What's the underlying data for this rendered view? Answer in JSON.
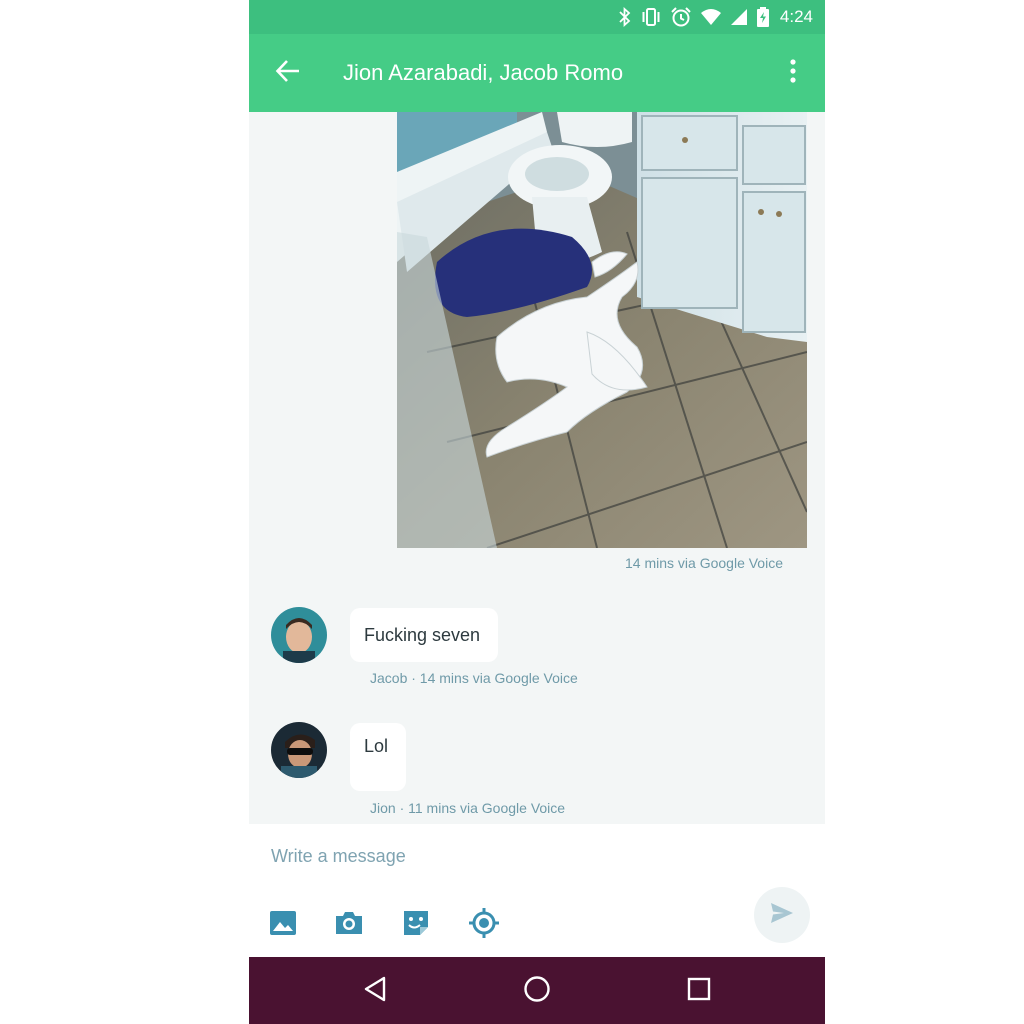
{
  "status_bar": {
    "time": "4:24",
    "icons": [
      "bluetooth-icon",
      "vibrate-icon",
      "alarm-icon",
      "wifi-icon",
      "signal-icon",
      "battery-charging-icon"
    ]
  },
  "app_bar": {
    "title": "Jion Azarabadi, Jacob Romo",
    "back_icon": "arrow-left-icon",
    "menu_icon": "more-vertical-icon"
  },
  "messages": [
    {
      "type": "image",
      "meta": "14 mins via Google Voice"
    },
    {
      "type": "text",
      "text": "Fucking seven",
      "meta": "Jacob · 14 mins via Google Voice"
    },
    {
      "type": "text",
      "text": "Lol",
      "meta": "Jion · 11 mins via Google Voice"
    }
  ],
  "composer": {
    "placeholder": "Write a message",
    "tools": [
      "gallery-icon",
      "camera-icon",
      "sticker-icon",
      "location-icon"
    ],
    "send_icon": "send-icon"
  },
  "nav_bar": {
    "icons": [
      "back-triangle-icon",
      "home-circle-icon",
      "recents-square-icon"
    ]
  },
  "colors": {
    "status_bar": "#3dbf7f",
    "app_bar": "#45cc86",
    "conversation_bg": "#f3f6f6",
    "meta_text": "#6f9aa8",
    "nav_bar": "#4a1231",
    "icon_accent": "#3a8fb0"
  }
}
